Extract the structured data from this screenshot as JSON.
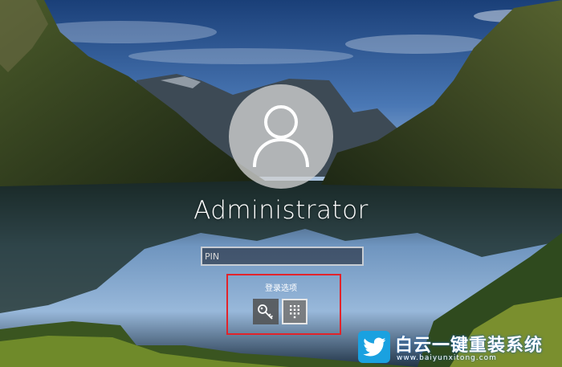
{
  "login": {
    "username": "Administrator",
    "pin_placeholder": "PIN",
    "sign_in_options_label": "登录选项",
    "options": [
      {
        "name": "security-key-option",
        "icon": "key-icon"
      },
      {
        "name": "pin-option",
        "icon": "keypad-icon"
      }
    ]
  },
  "watermark": {
    "brand": "白云一键重装系统",
    "url": "www.baiyunxitong.com",
    "icon": "twitter-bird-icon"
  },
  "colors": {
    "highlight_box": "#e2232a",
    "brand_blue": "#1aa1e0"
  }
}
